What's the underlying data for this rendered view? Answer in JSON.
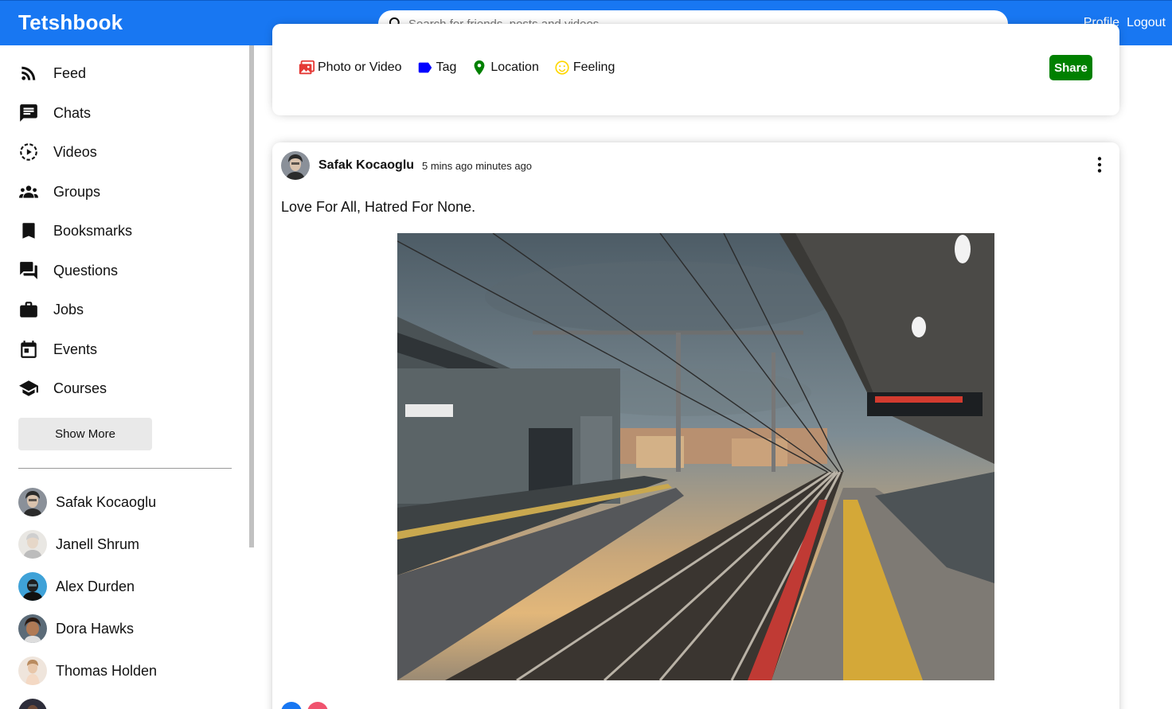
{
  "app": {
    "logo": "Tetshbook",
    "search_placeholder": "Search for friends, posts and videos",
    "nav_links": [
      "Profile",
      "Logout"
    ]
  },
  "sidebar": {
    "items": [
      {
        "label": "Feed",
        "icon": "rss-icon"
      },
      {
        "label": "Chats",
        "icon": "chat-icon"
      },
      {
        "label": "Videos",
        "icon": "play-circle-icon"
      },
      {
        "label": "Groups",
        "icon": "group-icon"
      },
      {
        "label": "Booksmarks",
        "icon": "bookmark-icon"
      },
      {
        "label": "Questions",
        "icon": "forum-icon"
      },
      {
        "label": "Jobs",
        "icon": "briefcase-icon"
      },
      {
        "label": "Events",
        "icon": "calendar-icon"
      },
      {
        "label": "Courses",
        "icon": "graduation-cap-icon"
      }
    ],
    "show_more": "Show More",
    "friends": [
      "Safak Kocaoglu",
      "Janell Shrum",
      "Alex Durden",
      "Dora Hawks",
      "Thomas Holden"
    ]
  },
  "share": {
    "options": [
      {
        "label": "Photo or Video",
        "icon": "photo-icon",
        "color": "#e53935"
      },
      {
        "label": "Tag",
        "icon": "label-icon",
        "color": "#0000ff"
      },
      {
        "label": "Location",
        "icon": "location-pin-icon",
        "color": "#008000"
      },
      {
        "label": "Feeling",
        "icon": "smiley-icon",
        "color": "#ffd700"
      }
    ],
    "button": "Share"
  },
  "post": {
    "username": "Safak Kocaoglu",
    "time": "5 mins ago minutes ago",
    "text": "Love For All, Hatred For None.",
    "image": "train-station-photo"
  },
  "colors": {
    "brand": "#1877f2",
    "share_button": "#008000"
  }
}
